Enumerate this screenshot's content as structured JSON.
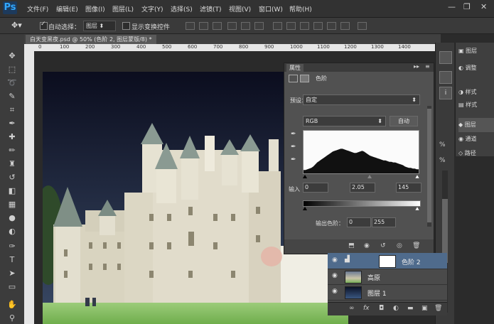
{
  "app": {
    "logo": "Ps"
  },
  "menu": {
    "items": [
      "文件(F)",
      "编辑(E)",
      "图像(I)",
      "图层(L)",
      "文字(Y)",
      "选择(S)",
      "滤镜(T)",
      "视图(V)",
      "窗口(W)",
      "帮助(H)"
    ]
  },
  "window_controls": {
    "minimize": "—",
    "restore": "❐",
    "close": "✕"
  },
  "options_bar": {
    "auto_select_label": "自动选择：",
    "auto_select_value": "图层",
    "show_transform_label": "显示变换控件"
  },
  "document": {
    "tab_title": "白天变黑夜.psd @ 50% (色阶 2, 图层蒙版/8) *",
    "ruler_marks": [
      "0",
      "100",
      "200",
      "300",
      "400",
      "500",
      "600",
      "700",
      "800",
      "900",
      "1000",
      "1100",
      "1200",
      "1300",
      "1400"
    ]
  },
  "properties": {
    "tab_label": "属性",
    "panel_title": "色阶",
    "preset_label": "预设：",
    "preset_value": "自定",
    "channel_value": "RGB",
    "auto_button": "自动",
    "input_label": "输入",
    "input_values": [
      "0",
      "2.05",
      "145"
    ],
    "output_label": "输出色阶：",
    "output_values": [
      "0",
      "255"
    ],
    "histogram": [
      0.05,
      0.05,
      0.06,
      0.07,
      0.08,
      0.1,
      0.13,
      0.16,
      0.18,
      0.2,
      0.22,
      0.24,
      0.26,
      0.28,
      0.3,
      0.32,
      0.33,
      0.34,
      0.35,
      0.36,
      0.36,
      0.35,
      0.34,
      0.33,
      0.32,
      0.31,
      0.3,
      0.3,
      0.31,
      0.32,
      0.33,
      0.32,
      0.3,
      0.28,
      0.26,
      0.25,
      0.24,
      0.23,
      0.22,
      0.21,
      0.2,
      0.19,
      0.19,
      0.18,
      0.17,
      0.17,
      0.16,
      0.16,
      0.15,
      0.14,
      0.13,
      0.12,
      0.1,
      0.09,
      0.08,
      0.08,
      0.07,
      0.07,
      0.06,
      0.06
    ]
  },
  "right_panel": {
    "items": [
      {
        "icon": "layers-stack-icon",
        "label": "图层"
      },
      {
        "icon": "adjust-icon",
        "label": "调整"
      },
      {
        "icon": "style-icon",
        "label": "样式"
      },
      {
        "icon": "layers-icon",
        "label": "图层"
      },
      {
        "icon": "channels-icon",
        "label": "通道"
      },
      {
        "icon": "paths-icon",
        "label": "路径"
      }
    ]
  },
  "layers": [
    {
      "name": "色阶 2",
      "selected": true
    },
    {
      "name": "高原",
      "selected": false
    },
    {
      "name": "图层 1",
      "selected": false
    }
  ],
  "colors": {
    "selection": "#4f6b8c",
    "accent": "#31a8ff"
  }
}
